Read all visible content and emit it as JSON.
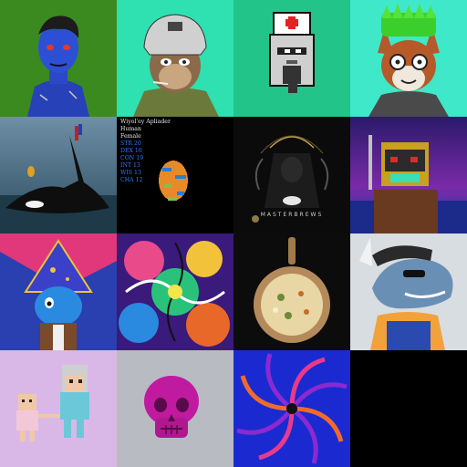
{
  "gallery": {
    "tiles": [
      {
        "label": "blue-zombie-avatar"
      },
      {
        "label": "ape-pilot-helmet"
      },
      {
        "label": "pixel-punk-nurse-cap"
      },
      {
        "label": "fox-grass-hat"
      },
      {
        "label": "orca-surreal-scene"
      },
      {
        "label": "character-stats-egg"
      },
      {
        "label": "dark-throne-art"
      },
      {
        "label": "pixel-warrior-helmet"
      },
      {
        "label": "wizard-blue-creature"
      },
      {
        "label": "psychedelic-art"
      },
      {
        "label": "pizza-board"
      },
      {
        "label": "shark-basketball"
      },
      {
        "label": "pixel-family"
      },
      {
        "label": "pink-skull"
      },
      {
        "label": "spiral-pattern"
      }
    ]
  },
  "stats_card": {
    "name": "Wiyol'ey Apliader",
    "race": "Human",
    "sex": "Female",
    "attributes": [
      "STR 20",
      "DEX 10",
      "CON 19",
      "INT 13",
      "WIS 13",
      "CHA 12"
    ]
  },
  "throne_art": {
    "brand": "MASTERBREWS"
  },
  "colors": {
    "attr_blue": "#2f7bff",
    "green_bg": "#3a8a1f",
    "teal_bg": "#1fc98a",
    "mint_bg": "#3ee6c0"
  }
}
